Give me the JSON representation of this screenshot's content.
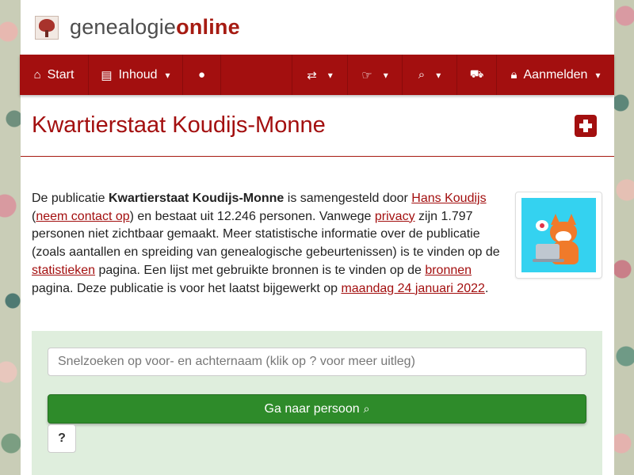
{
  "brand": {
    "name_prefix": "genealogie",
    "name_suffix": "online",
    "logo_icon": "tree-logo-icon"
  },
  "nav": {
    "items": [
      {
        "label": "Start",
        "icon": "home-icon"
      },
      {
        "label": "Inhoud",
        "icon": "book-icon"
      },
      {
        "label": "",
        "icon": "comments-icon"
      },
      {
        "label": "",
        "icon": "language-icon"
      },
      {
        "label": "",
        "icon": "hand-pointer-icon"
      },
      {
        "label": "",
        "icon": "search-icon"
      },
      {
        "label": "",
        "icon": "cart-icon"
      },
      {
        "label": "Aanmelden",
        "icon": "lock-icon"
      }
    ]
  },
  "page": {
    "title": "Kwartierstaat Koudijs-Monne"
  },
  "intro": {
    "t1": "De publicatie ",
    "pub_name": "Kwartierstaat Koudijs-Monne",
    "t2": " is samengesteld door ",
    "author_link": "Hans Koudijs",
    "t3": "(",
    "contact_link": "neem contact op",
    "t4": ") en bestaat uit 12.246 personen. Vanwege ",
    "privacy_link": "privacy",
    "t5": " zijn 1.797 personen niet zichtbaar gemaakt. Meer statistische informatie over de publicatie (zoals aantallen en spreiding van genealogische gebeurtenissen) is te vinden op de ",
    "stats_link": "statistieken",
    "t6": " pagina. Een lijst met gebruikte bronnen is te vinden op de ",
    "sources_link": "bronnen",
    "t7": " pagina. Deze publicatie is voor het laatst bijgewerkt op ",
    "date_link": "maandag 24 januari 2022",
    "t8": "."
  },
  "search": {
    "placeholder": "Snelzoeken op voor- en achternaam (klik op ? voor meer uitleg)",
    "value": "",
    "go_label": "Ga naar persoon",
    "help_label": "?"
  },
  "colors": {
    "primary": "#a30f0f",
    "success": "#2e8b2a",
    "panel": "#dfeedd"
  }
}
